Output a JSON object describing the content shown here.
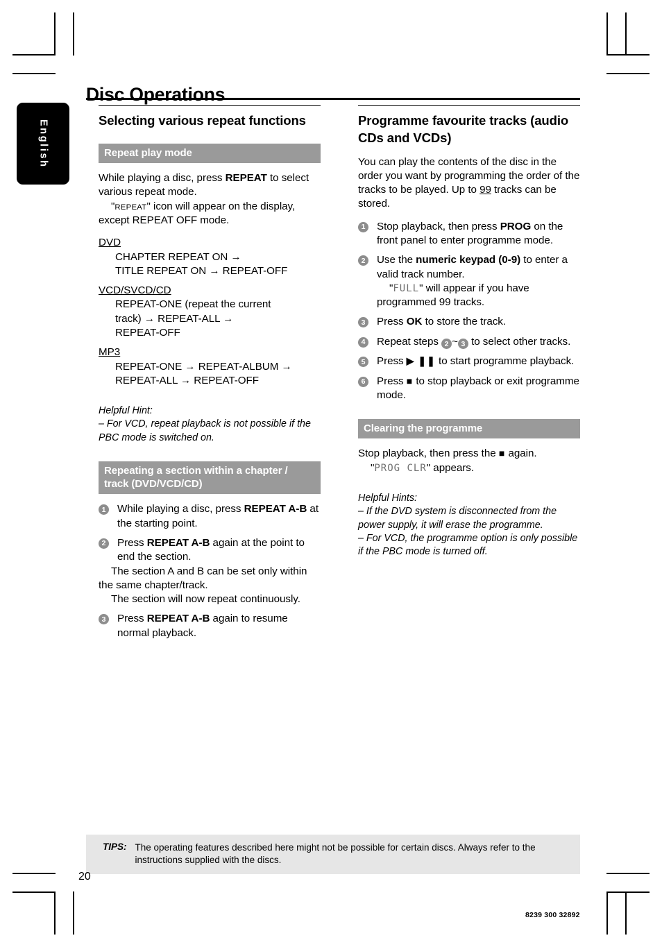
{
  "page": {
    "title": "Disc Operations",
    "language_tab": "English",
    "folio": "20",
    "doc_number": "8239 300 32892"
  },
  "left_column": {
    "heading": "Selecting various repeat functions",
    "band1": "Repeat play mode",
    "intro_line1_pre": "While playing a disc, press ",
    "intro_line1_bold": "REPEAT",
    "intro_line1_post": " to select various repeat mode.",
    "intro_line2_pre": "\"",
    "intro_line2_smallcaps": "REPEAT",
    "intro_line2_post": "\" icon will appear on the display, except REPEAT OFF mode.",
    "groups": [
      {
        "label": "DVD",
        "lines": [
          "CHAPTER REPEAT ON →",
          "TITLE REPEAT ON → REPEAT-OFF"
        ]
      },
      {
        "label": "VCD/SVCD/CD",
        "lines": [
          "REPEAT-ONE (repeat the current",
          "track) → REPEAT-ALL →",
          "REPEAT-OFF"
        ]
      },
      {
        "label": "MP3",
        "lines": [
          "REPEAT-ONE → REPEAT-ALBUM →",
          "REPEAT-ALL → REPEAT-OFF"
        ]
      }
    ],
    "hint_title": "Helpful Hint:",
    "hint_body": "– For VCD, repeat playback is not possible if the PBC mode is switched on.",
    "band2": "Repeating a section within a chapter / track (DVD/VCD/CD)",
    "steps": [
      {
        "num": "1",
        "pre": "While playing a disc, press ",
        "bold": "REPEAT A-B",
        "post": " at the starting point.",
        "extra": []
      },
      {
        "num": "2",
        "pre": "Press ",
        "bold": "REPEAT A-B",
        "post": " again at the point to end the section.",
        "extra": [
          "The section A and B can be set only within the same chapter/track.",
          "The section will now repeat continuously."
        ]
      },
      {
        "num": "3",
        "pre": "Press ",
        "bold": "REPEAT A-B",
        "post": " again to resume normal playback.",
        "extra": []
      }
    ]
  },
  "right_column": {
    "heading": "Programme favourite tracks (audio CDs and VCDs)",
    "intro_pre": "You can play the contents of the disc in the order you want by programming the order of the tracks to be played. Up to ",
    "intro_underline": "99",
    "intro_post": " tracks can be stored.",
    "steps": [
      {
        "num": "1",
        "pre": "Stop playback, then press ",
        "bold": "PROG",
        "post": " on the front panel to enter programme mode.",
        "extra": []
      },
      {
        "num": "2",
        "pre": "Use the ",
        "bold": "numeric keypad (0-9)",
        "post": " to enter a valid track number.",
        "extra_lcd_pre": "\"",
        "extra_lcd": "FULL",
        "extra_lcd_post": "\" will appear if you have programmed 99 tracks."
      },
      {
        "num": "3",
        "pre": "Press ",
        "bold": "OK",
        "post": " to store the track.",
        "extra": []
      },
      {
        "num": "4",
        "pre": "Repeat steps ",
        "ref_a": "2",
        "mid": "~",
        "ref_b": "3",
        "post": " to select other tracks.",
        "extra": []
      },
      {
        "num": "5",
        "pre": "Press ",
        "symbol": "▶ ❚❚",
        "post": " to start programme playback.",
        "extra": []
      },
      {
        "num": "6",
        "pre": "Press ",
        "symbol": "■",
        "post": " to stop playback or exit programme mode.",
        "extra": []
      }
    ],
    "band_clearing": "Clearing the programme",
    "clearing_pre": "Stop playback, then press the ",
    "clearing_symbol": "■",
    "clearing_post": " again.",
    "clearing_lcd_pre": "\"",
    "clearing_lcd": "PROG CLR",
    "clearing_lcd_post": "\" appears.",
    "hint_title": "Helpful Hints:",
    "hint_1": "– If the DVD system is disconnected from the power supply, it will erase the programme.",
    "hint_2": "– For VCD, the programme option is only possible if the PBC mode is turned off."
  },
  "footer": {
    "tips_label": "TIPS:",
    "tips_text": "The operating features described here might not be possible for certain discs.  Always refer to the instructions supplied with the discs."
  }
}
